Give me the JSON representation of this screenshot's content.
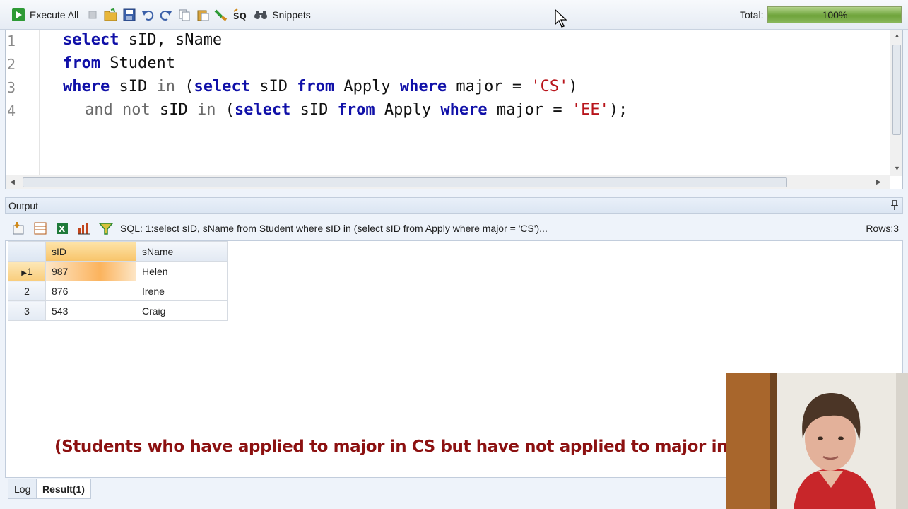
{
  "toolbar": {
    "execute_all": "Execute All",
    "snippets": "Snippets",
    "total_label": "Total:",
    "progress_text": "100%",
    "progress_value": 1.0
  },
  "editor": {
    "line_numbers": [
      "1",
      "2",
      "3",
      "4"
    ]
  },
  "output": {
    "title": "Output",
    "sql_text": "SQL: 1:select sID, sName  from Student  where sID in (select sID from Apply where major = 'CS')...",
    "rows_text": "Rows:3",
    "columns": [
      "sID",
      "sName"
    ],
    "rows": [
      {
        "num": "1",
        "sID": "987",
        "sName": "Helen"
      },
      {
        "num": "2",
        "sID": "876",
        "sName": "Irene"
      },
      {
        "num": "3",
        "sID": "543",
        "sName": "Craig"
      }
    ]
  },
  "caption": "(Students who have applied to major in CS but have not applied to major in EE)",
  "tabs": {
    "log": "Log",
    "result": "Result(1)"
  },
  "colors": {
    "keyword": "#1010a8",
    "string": "#b8141b",
    "caption": "#8c1111",
    "progress": "#6ea33a"
  }
}
